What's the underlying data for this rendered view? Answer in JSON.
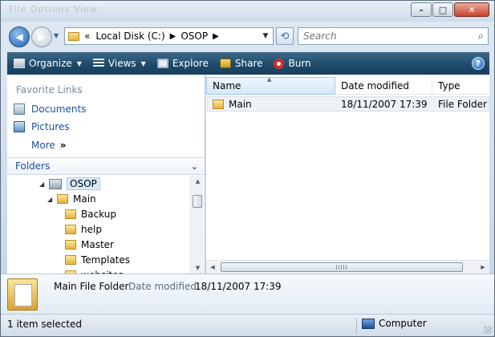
{
  "titlebar": {
    "menu_ghost": "File   Options   View"
  },
  "address": {
    "overflow": "«",
    "segments": [
      "Local Disk (C:)",
      "OSOP"
    ]
  },
  "search": {
    "placeholder": "Search"
  },
  "toolbar": {
    "organize": "Organize",
    "views": "Views",
    "explore": "Explore",
    "share": "Share",
    "burn": "Burn",
    "help": "?"
  },
  "favorites": {
    "title": "Favorite Links",
    "items": [
      "Documents",
      "Pictures"
    ],
    "more": "More"
  },
  "folders": {
    "label": "Folders",
    "tree": [
      {
        "label": "OSOP",
        "selected": true
      },
      {
        "label": "Main"
      },
      {
        "label": "Backup"
      },
      {
        "label": "help"
      },
      {
        "label": "Master"
      },
      {
        "label": "Templates"
      },
      {
        "label": "websites"
      }
    ]
  },
  "columns": {
    "name": "Name",
    "date": "Date modified",
    "type": "Type"
  },
  "files": [
    {
      "name": "Main",
      "date": "18/11/2007 17:39",
      "type": "File Folder"
    }
  ],
  "details": {
    "name": "Main File Folder",
    "date_key": "Date modified:",
    "date_value": "18/11/2007 17:39"
  },
  "status": {
    "selected": "1 item selected",
    "location": "Computer"
  },
  "colors": {
    "toolbar": "#1e4a6b",
    "link": "#1c4fa0",
    "selection": "#d9ebfb"
  }
}
